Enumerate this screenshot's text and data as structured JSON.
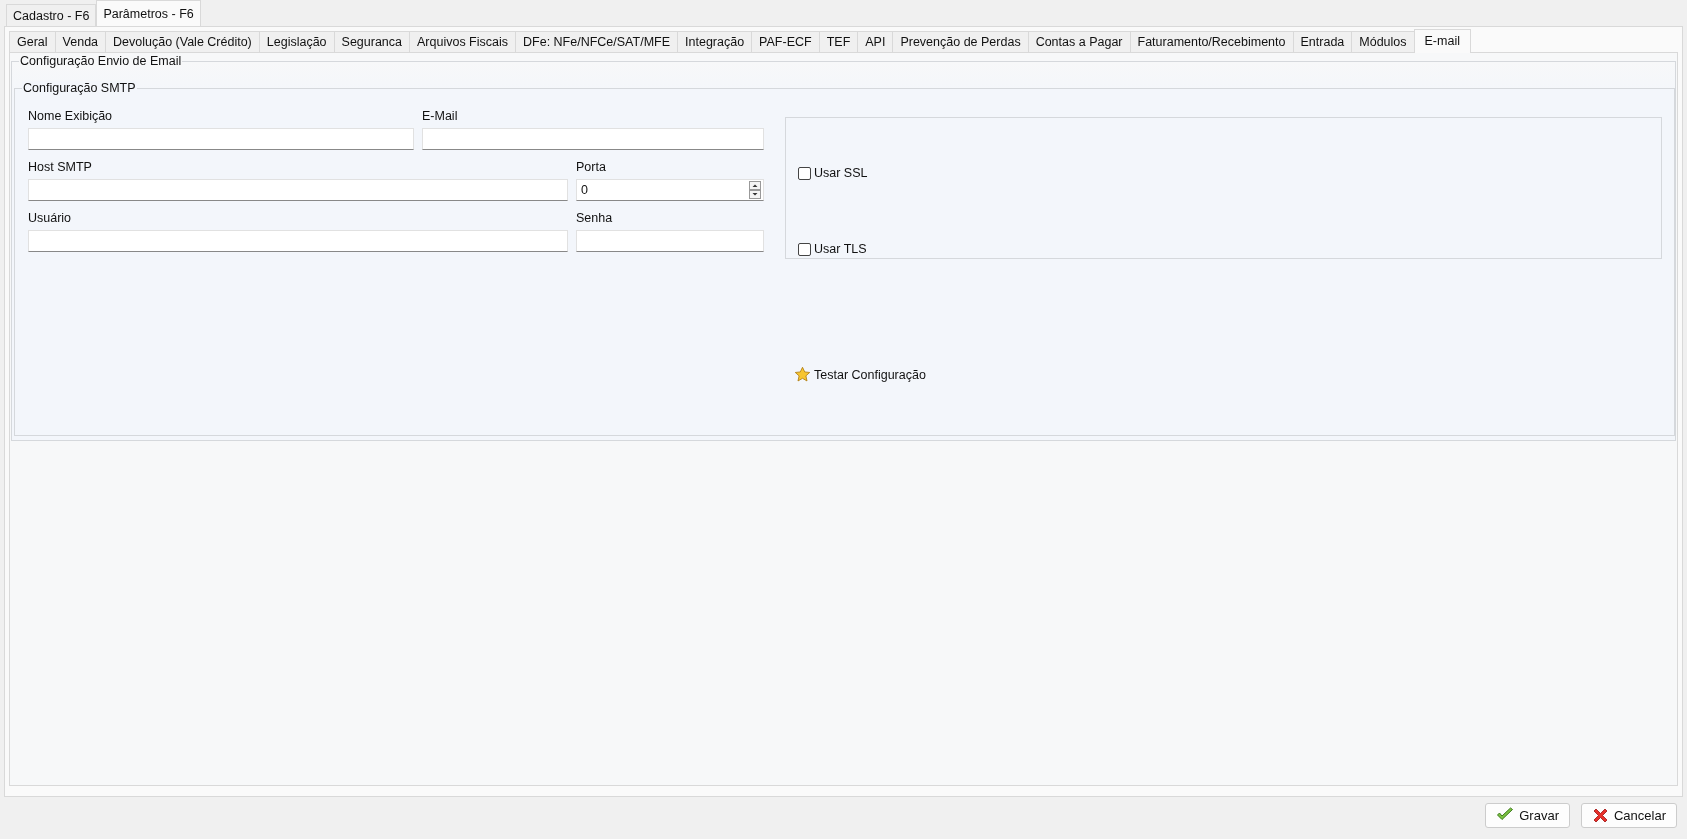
{
  "top_tabs": [
    {
      "label": "Cadastro - F6",
      "selected": false
    },
    {
      "label": "Parâmetros - F6",
      "selected": true
    }
  ],
  "tabs": [
    {
      "label": "Geral",
      "selected": false
    },
    {
      "label": "Venda",
      "selected": false
    },
    {
      "label": "Devolução (Vale Crédito)",
      "selected": false
    },
    {
      "label": "Legislação",
      "selected": false
    },
    {
      "label": "Seguranca",
      "selected": false
    },
    {
      "label": "Arquivos Fiscais",
      "selected": false
    },
    {
      "label": "DFe: NFe/NFCe/SAT/MFE",
      "selected": false
    },
    {
      "label": "Integração",
      "selected": false
    },
    {
      "label": "PAF-ECF",
      "selected": false
    },
    {
      "label": "TEF",
      "selected": false
    },
    {
      "label": "API",
      "selected": false
    },
    {
      "label": "Prevenção de Perdas",
      "selected": false
    },
    {
      "label": "Contas a Pagar",
      "selected": false
    },
    {
      "label": "Faturamento/Recebimento",
      "selected": false
    },
    {
      "label": "Entrada",
      "selected": false
    },
    {
      "label": "Módulos",
      "selected": false
    },
    {
      "label": "E-mail",
      "selected": true
    }
  ],
  "group_title": "Configuração Envio de Email",
  "smtp": {
    "title": "Configuração SMTP",
    "fields": [
      {
        "label": "Nome Exibição",
        "kind": "text"
      },
      {
        "label": "E-Mail",
        "kind": "text"
      },
      {
        "label": "Host SMTP",
        "kind": "text"
      },
      {
        "label": "Porta",
        "kind": "spin",
        "value": "0"
      },
      {
        "label": "Usuário",
        "kind": "text"
      },
      {
        "label": "Senha",
        "kind": "text"
      }
    ],
    "options": [
      {
        "label": "Usar SSL",
        "checked": false
      },
      {
        "label": "Usar TLS",
        "checked": false
      }
    ],
    "test_button": "Testar Configuração"
  },
  "buttons": [
    {
      "label": "Gravar",
      "kind": "save"
    },
    {
      "label": "Cancelar",
      "kind": "cancel"
    }
  ]
}
